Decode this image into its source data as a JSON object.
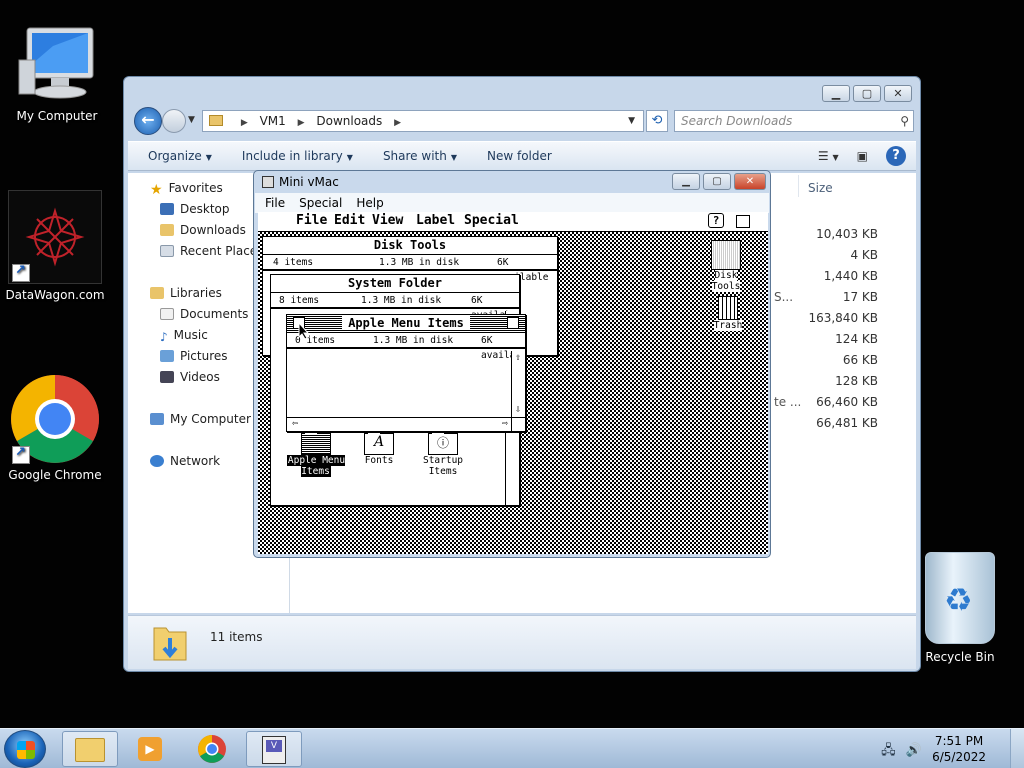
{
  "desktop": {
    "icons": [
      {
        "label": "My Computer"
      },
      {
        "label": "DataWagon.com"
      },
      {
        "label": "Google Chrome"
      }
    ],
    "recycle_bin": "Recycle Bin"
  },
  "explorer": {
    "breadcrumb": [
      "VM1",
      "Downloads"
    ],
    "search_placeholder": "Search Downloads",
    "toolbar": {
      "organize": "Organize",
      "include": "Include in library",
      "share": "Share with",
      "new_folder": "New folder"
    },
    "nav": {
      "favorites": "Favorites",
      "desktop": "Desktop",
      "downloads": "Downloads",
      "recent": "Recent Places",
      "libraries": "Libraries",
      "documents": "Documents",
      "music": "Music",
      "pictures": "Pictures",
      "videos": "Videos",
      "my_computer": "My Computer",
      "network": "Network"
    },
    "column_size": "Size",
    "sizes": [
      "10,403 KB",
      "4 KB",
      "1,440 KB",
      "17 KB",
      "163,840 KB",
      "124 KB",
      "66 KB",
      "128 KB",
      "66,460 KB",
      "66,481 KB"
    ],
    "truncated": {
      "row4": "S...",
      "row9": "te ..."
    },
    "status": "11 items"
  },
  "vmac": {
    "title": "Mini vMac",
    "menu": [
      "File",
      "Special",
      "Help"
    ],
    "mac_menu": [
      "File",
      "Edit",
      "View",
      "Label",
      "Special"
    ],
    "disk_tools": {
      "title": "Disk Tools",
      "items": "4 items",
      "disk": "1.3 MB in disk",
      "avail": "6K available"
    },
    "system_folder": {
      "title": "System Folder",
      "items": "8 items",
      "disk": "1.3 MB in disk",
      "avail": "6K availab"
    },
    "apple_menu": {
      "title": "Apple Menu Items",
      "items": "0 items",
      "disk": "1.3 MB in disk",
      "avail": "6K availa"
    },
    "folder_icons": [
      "Apple Menu Items",
      "Fonts",
      "Startup Items"
    ],
    "desk_icons": [
      "Disk Tools",
      "Trash"
    ]
  },
  "taskbar": {
    "time": "7:51 PM",
    "date": "6/5/2022"
  }
}
